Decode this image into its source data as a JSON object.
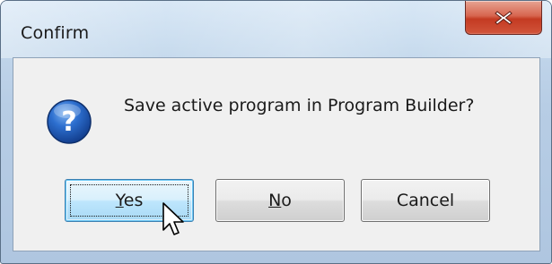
{
  "dialog": {
    "title": "Confirm",
    "message": "Save active program in Program Builder?",
    "icon": "question-icon"
  },
  "buttons": {
    "yes": {
      "mnemonic": "Y",
      "rest": "es"
    },
    "no": {
      "mnemonic": "N",
      "rest": "o"
    },
    "cancel": {
      "label": "Cancel"
    }
  },
  "colors": {
    "close_button": "#c43a22",
    "question_icon": "#1c5dbb",
    "default_button_border": "#3c7fb1"
  }
}
